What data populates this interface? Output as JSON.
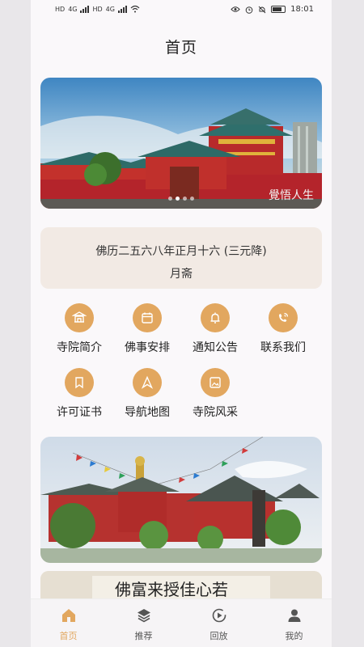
{
  "status_bar": {
    "time": "18:01",
    "network_labels": [
      "HD",
      "4G",
      "HD",
      "4G"
    ]
  },
  "header": {
    "title": "首页"
  },
  "banner": {
    "page_count": 4,
    "active_index": 1,
    "signboard_text": "覺悟人生"
  },
  "calendar": {
    "line1": "佛历二五六八年正月十六 (三元降)",
    "line2": "月斋"
  },
  "menu": [
    {
      "label": "寺院简介",
      "icon": "temple-icon"
    },
    {
      "label": "佛事安排",
      "icon": "calendar-icon"
    },
    {
      "label": "通知公告",
      "icon": "bell-icon"
    },
    {
      "label": "联系我们",
      "icon": "phone-icon"
    },
    {
      "label": "许可证书",
      "icon": "bookmark-icon"
    },
    {
      "label": "导航地图",
      "icon": "navigation-icon"
    },
    {
      "label": "寺院风采",
      "icon": "image-icon"
    }
  ],
  "calligraphy": {
    "text": "佛富来授佳心若"
  },
  "tabbar": {
    "items": [
      {
        "label": "首页",
        "icon": "home-icon",
        "active": true
      },
      {
        "label": "推荐",
        "icon": "layers-icon",
        "active": false
      },
      {
        "label": "回放",
        "icon": "replay-icon",
        "active": false
      },
      {
        "label": "我的",
        "icon": "user-icon",
        "active": false
      }
    ]
  },
  "colors": {
    "accent": "#e2a75f",
    "calendar_bg": "#f2eae4",
    "page_bg": "#faf8fa"
  }
}
